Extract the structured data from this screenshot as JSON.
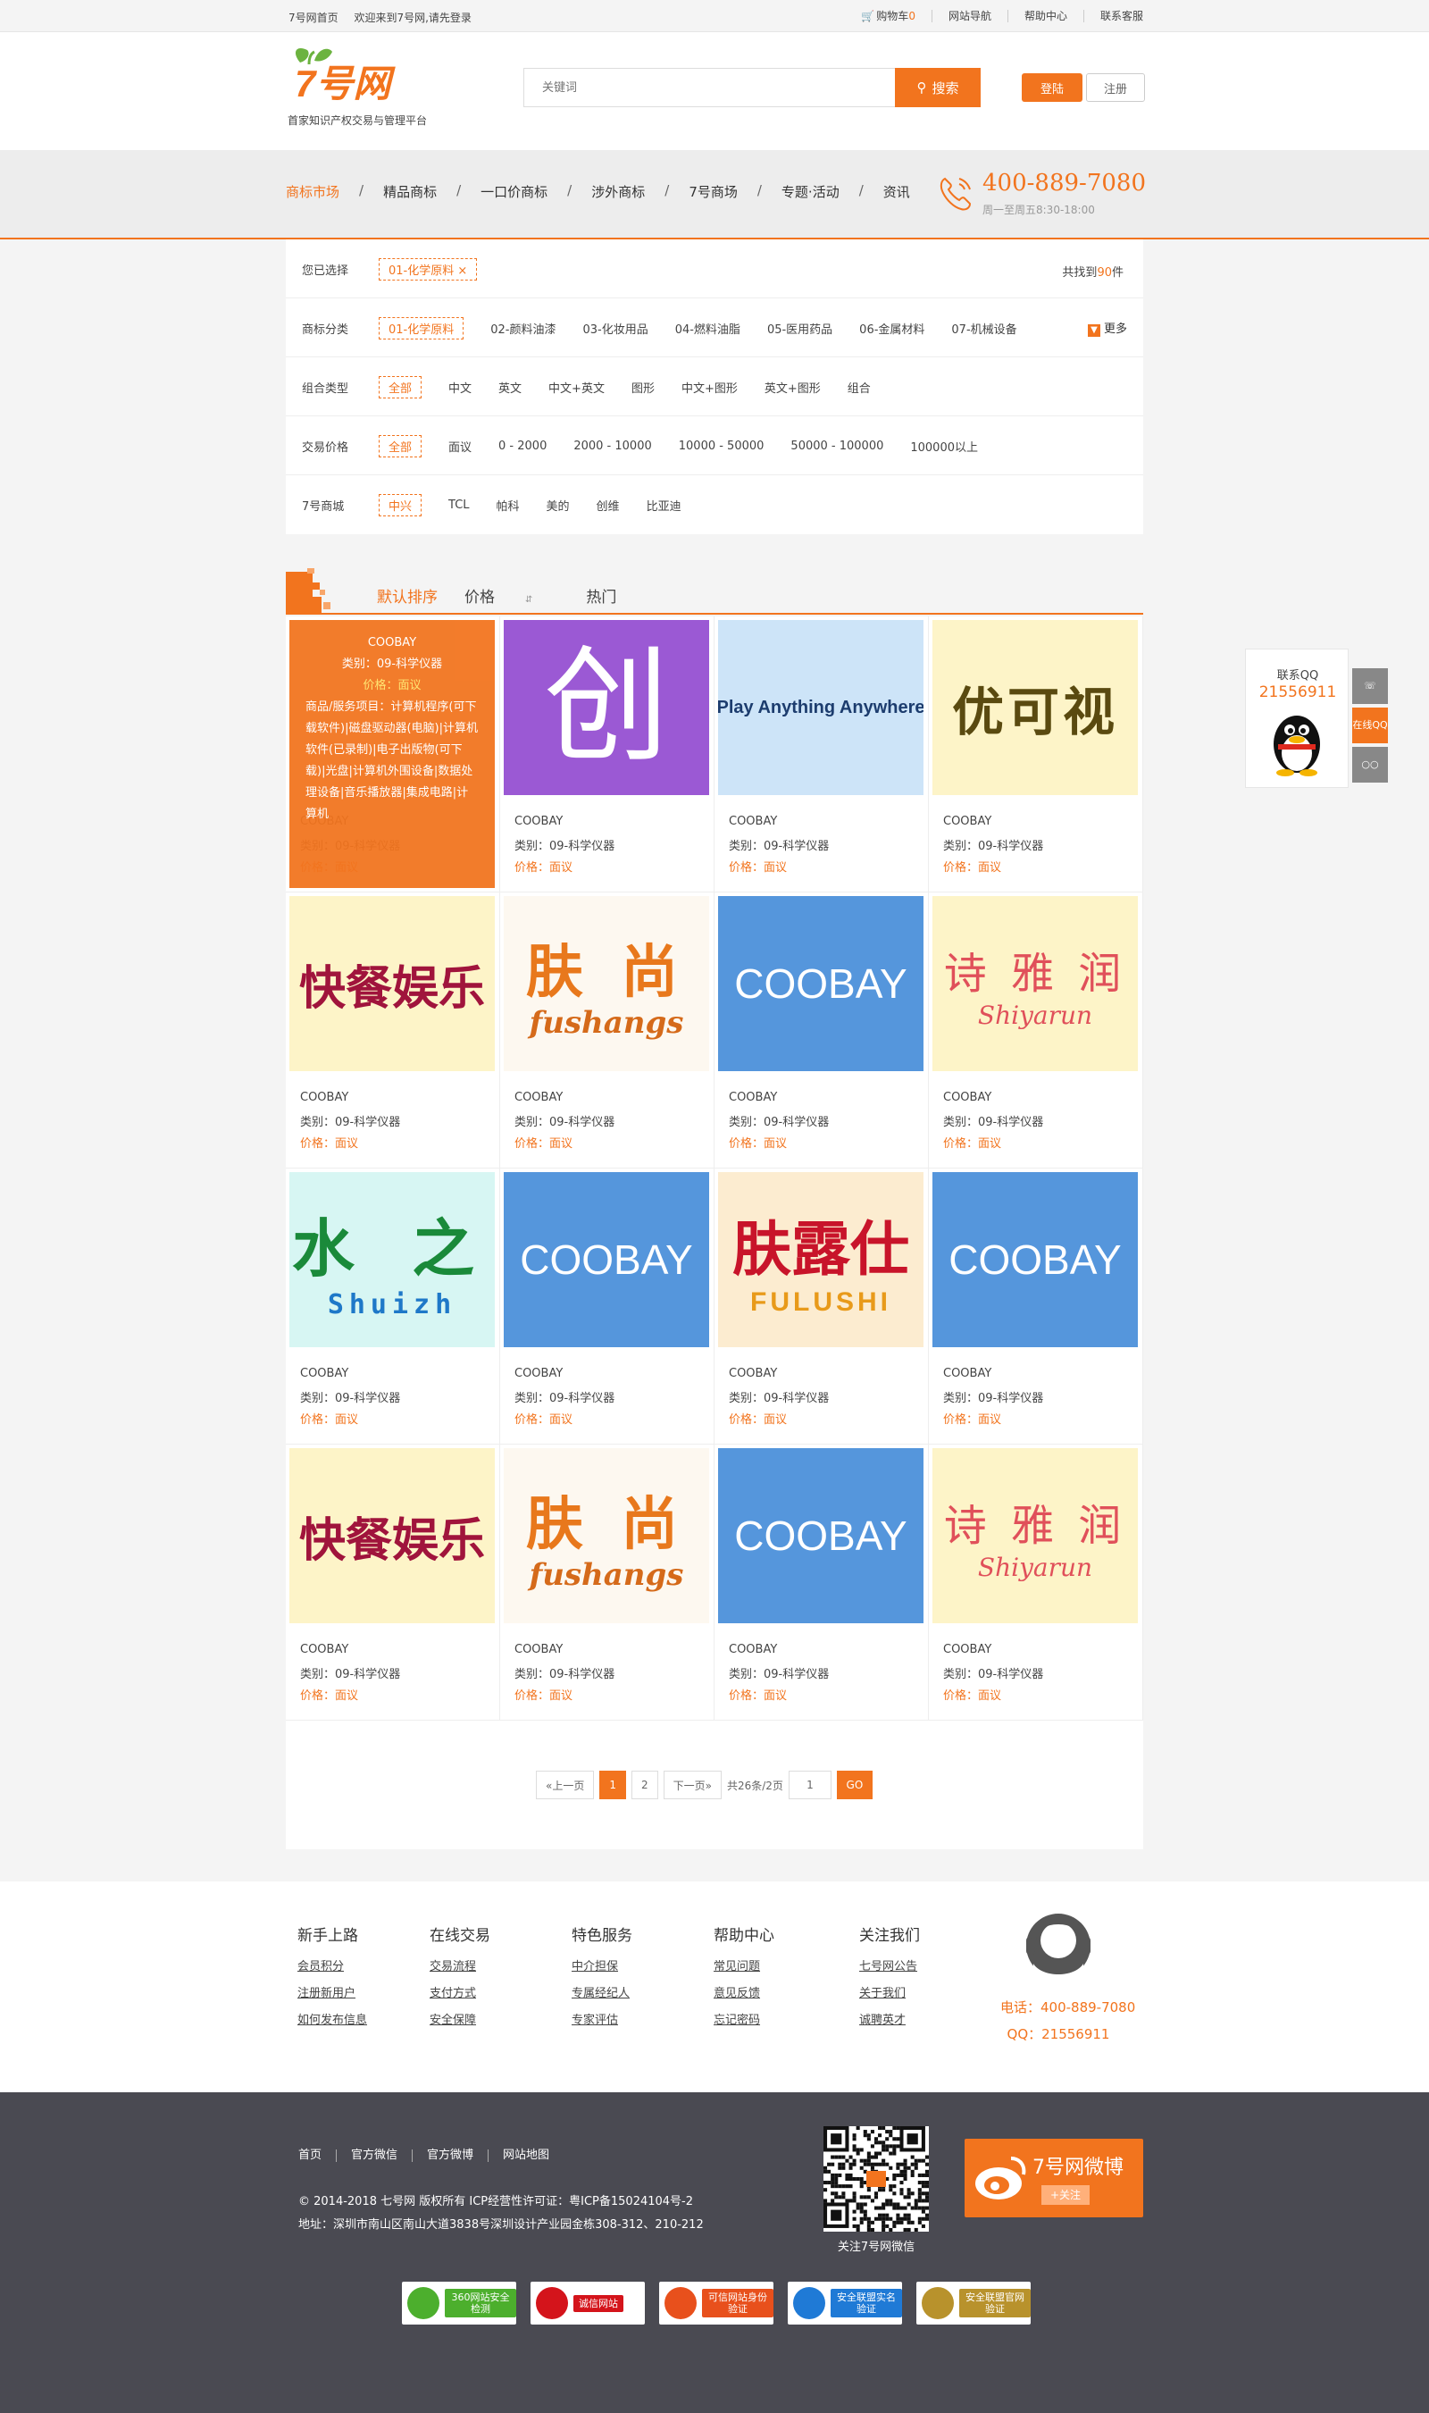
{
  "topbar": {
    "home": "7号网首页",
    "welcome": "欢迎来到7号网,请先登录",
    "cart_label": "购物车",
    "cart_count": "0",
    "site_nav": "网站导航",
    "help": "帮助中心",
    "contact": "联系客服"
  },
  "header": {
    "logo_text": "7号网",
    "slogan": "首家知识产权交易与管理平台",
    "search_placeholder": "关键词",
    "search_button": "搜索",
    "login": "登陆",
    "register": "注册"
  },
  "nav": {
    "items": [
      "商标市场",
      "精品商标",
      "一口价商标",
      "涉外商标",
      "7号商场",
      "专题·活动",
      "资讯"
    ],
    "phone": "400-889-7080",
    "hours": "周一至周五8:30-18:00"
  },
  "filter": {
    "selected_label": "您已选择",
    "selected_tag": "01-化学原料 ×",
    "found_prefix": "共找到",
    "found_count": "90",
    "found_suffix": "件",
    "rows": [
      {
        "label": "商标分类",
        "options": [
          "01-化学原料",
          "02-颜料油漆",
          "03-化妆用品",
          "04-燃料油脂",
          "05-医用药品",
          "06-金属材料",
          "07-机械设备"
        ],
        "more": "更多"
      },
      {
        "label": "组合类型",
        "options": [
          "全部",
          "中文",
          "英文",
          "中文+英文",
          "图形",
          "中文+图形",
          "英文+图形",
          "组合"
        ]
      },
      {
        "label": "交易价格",
        "options": [
          "全部",
          "面议",
          "0 - 2000",
          "2000 - 10000",
          "10000 - 50000",
          "50000 - 100000",
          "100000以上"
        ]
      },
      {
        "label": "7号商城",
        "options": [
          "中兴",
          "TCL",
          "帕科",
          "美的",
          "创维",
          "比亚迪"
        ]
      }
    ]
  },
  "sort": {
    "options": [
      "默认排序",
      "价格",
      "热门"
    ]
  },
  "overlay": {
    "name": "COOBAY",
    "category": "类别：09-科学仪器",
    "price": "价格：面议",
    "desc": "商品/服务项目：计算机程序(可下载软件)|磁盘驱动器(电脑)|计算机软件(已录制)|电子出版物(可下载)|光盘|计算机外围设备|数据处理设备|音乐播放器|集成电路|计算机"
  },
  "card_common": {
    "name": "COOBAY",
    "category": "类别：09-科学仪器",
    "price_label": "价格：",
    "price_value": "面议"
  },
  "cards": [
    {
      "logo": "",
      "style": "blank"
    },
    {
      "logo": "创",
      "style": "purple"
    },
    {
      "logo": "Play Anything Anywhere",
      "style": "lightblue"
    },
    {
      "logo": "优可视",
      "style": "cream"
    },
    {
      "logo": "快餐娱乐",
      "style": "kuaican"
    },
    {
      "logo": "肤 尚",
      "logo_sub": "fushangs",
      "style": "fushang"
    },
    {
      "logo": "COOBAY",
      "style": "blue"
    },
    {
      "logo": "诗 雅 润",
      "logo_sub": "Shiyarun",
      "style": "shiya"
    },
    {
      "logo": "水 之",
      "logo_sub": "Shuizh",
      "style": "shuizhi"
    },
    {
      "logo": "COOBAY",
      "style": "blue"
    },
    {
      "logo": "肤露仕",
      "logo_sub": "FULUSHI",
      "style": "fulushi"
    },
    {
      "logo": "COOBAY",
      "style": "blue"
    },
    {
      "logo": "快餐娱乐",
      "style": "kuaican"
    },
    {
      "logo": "肤 尚",
      "logo_sub": "fushangs",
      "style": "fushang"
    },
    {
      "logo": "COOBAY",
      "style": "blue"
    },
    {
      "logo": "诗 雅 润",
      "logo_sub": "Shiyarun",
      "style": "shiya"
    }
  ],
  "pager": {
    "prev": "«上一页",
    "pages": [
      "1",
      "2"
    ],
    "next": "下一页»",
    "info": "共26条/2页",
    "input": "1",
    "go": "GO"
  },
  "sidebar": {
    "qq_title": "联系QQ",
    "qq_number": "21556911",
    "online_label": "在线QQ"
  },
  "footer": {
    "cols": [
      {
        "title": "新手上路",
        "items": [
          "会员积分",
          "注册新用户",
          "如何发布信息"
        ]
      },
      {
        "title": "在线交易",
        "items": [
          "交易流程",
          "支付方式",
          "安全保障"
        ]
      },
      {
        "title": "特色服务",
        "items": [
          "中介担保",
          "专属经纪人",
          "专家评估"
        ]
      },
      {
        "title": "帮助中心",
        "items": [
          "常见问题",
          "意见反馈",
          "忘记密码"
        ]
      },
      {
        "title": "关注我们",
        "items": [
          "七号网公告",
          "关于我们",
          "诚聘英才"
        ]
      }
    ],
    "phone": "电话：400-889-7080",
    "qq": "QQ：21556911"
  },
  "bottom": {
    "links": [
      "首页",
      "官方微信",
      "官方微博",
      "网站地图"
    ],
    "copyright": "© 2014-2018 七号网 版权所有 ICP经营性许可证：粤ICP备15024104号-2",
    "address": "地址：深圳市南山区南山大道3838号深圳设计产业园金栋308-312、210-212",
    "qr_label": "关注7号网微信",
    "weibo": "7号网微博",
    "follow": "+关注",
    "badges": [
      "360网站安全检测",
      "诚信网站",
      "可信网站身份验证",
      "安全联盟实名验证",
      "安全联盟官网验证"
    ]
  },
  "colors": {
    "accent": "#f2741e",
    "dark_footer": "#4a4a52"
  }
}
